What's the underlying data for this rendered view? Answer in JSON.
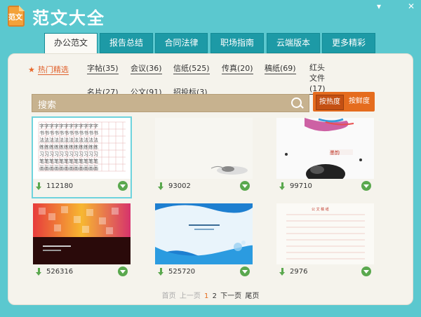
{
  "app": {
    "title": "范文大全",
    "logo_text": "范文"
  },
  "window_controls": {
    "minimize": "▾",
    "close": "✕"
  },
  "tabs": [
    {
      "label": "办公范文",
      "active": true
    },
    {
      "label": "报告总结",
      "active": false
    },
    {
      "label": "合同法律",
      "active": false
    },
    {
      "label": "职场指南",
      "active": false
    },
    {
      "label": "云端版本",
      "active": false
    },
    {
      "label": "更多精彩",
      "active": false
    }
  ],
  "hot": {
    "label": "热门精选"
  },
  "categories": [
    {
      "label": "字帖(35)"
    },
    {
      "label": "会议(36)"
    },
    {
      "label": "信纸(525)"
    },
    {
      "label": "传真(20)"
    },
    {
      "label": "稿纸(69)"
    },
    {
      "label": "红头文件(17)"
    },
    {
      "label": "名片(27)"
    },
    {
      "label": "公文(91)"
    },
    {
      "label": "招投标(3)"
    }
  ],
  "search": {
    "placeholder": "搜索"
  },
  "sort": {
    "hot": "按热度",
    "fresh": "按鲜度"
  },
  "cards": [
    {
      "count": "112180",
      "selected": true
    },
    {
      "count": "93002",
      "selected": false
    },
    {
      "count": "99710",
      "selected": false
    },
    {
      "count": "526316",
      "selected": false
    },
    {
      "count": "525720",
      "selected": false
    },
    {
      "count": "2976",
      "selected": false
    }
  ],
  "card4_title": "公 文 稿 纸",
  "pager": {
    "first": "首页",
    "prev": "上一页",
    "page1": "1",
    "page2": "2",
    "next": "下一页",
    "last": "尾页"
  },
  "colors": {
    "bg": "#5bc8cf",
    "tab": "#1d9aa6",
    "accent": "#e56c1e",
    "download": "#5aa84e"
  }
}
